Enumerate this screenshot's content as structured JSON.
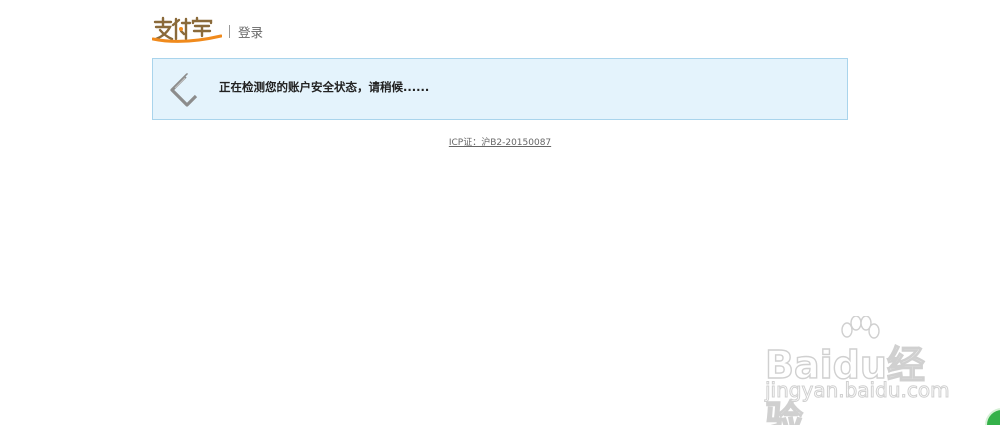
{
  "header": {
    "logo_text": "支付宝",
    "title": "登录"
  },
  "notice": {
    "icon": "loading-diamond-icon",
    "message": "正在检测您的账户安全状态，请稍候......"
  },
  "footer": {
    "icp_text": "ICP证：沪B2-20150087"
  },
  "watermark": {
    "brand": "Baidu经验",
    "url": "jingyan.baidu.com"
  },
  "colors": {
    "notice_bg": "#e4f3fc",
    "notice_border": "#a9d4ec",
    "logo_blue": "#1e6fb8",
    "logo_orange": "#f08a1c"
  }
}
